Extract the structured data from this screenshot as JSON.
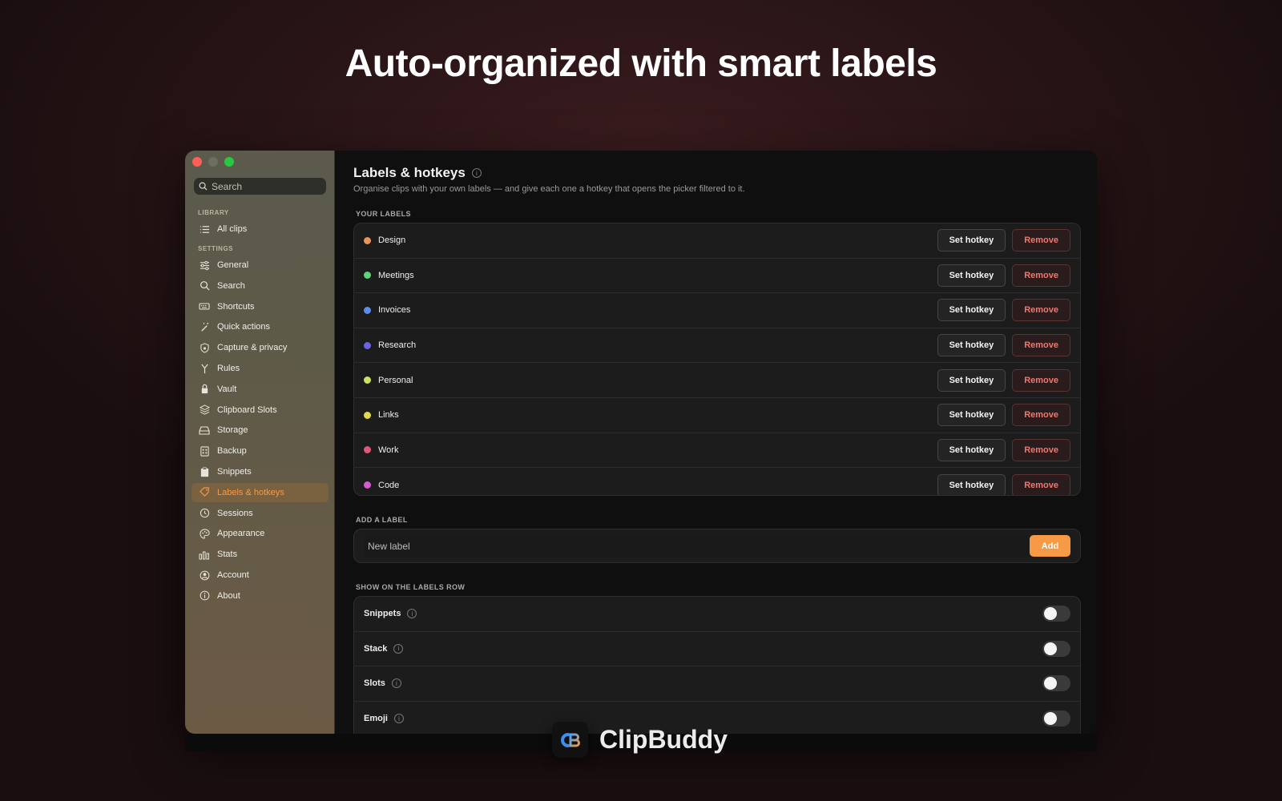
{
  "headline": "Auto-organized with smart labels",
  "sidebar": {
    "search_placeholder": "Search",
    "library_label": "LIBRARY",
    "settings_label": "SETTINGS",
    "library_items": [
      {
        "label": "All clips",
        "icon": "list-icon"
      }
    ],
    "settings_items": [
      {
        "label": "General",
        "icon": "sliders-icon"
      },
      {
        "label": "Search",
        "icon": "search-icon"
      },
      {
        "label": "Shortcuts",
        "icon": "keyboard-icon"
      },
      {
        "label": "Quick actions",
        "icon": "wand-icon"
      },
      {
        "label": "Capture & privacy",
        "icon": "shield-icon"
      },
      {
        "label": "Rules",
        "icon": "branch-icon"
      },
      {
        "label": "Vault",
        "icon": "lock-icon"
      },
      {
        "label": "Clipboard Slots",
        "icon": "layers-icon"
      },
      {
        "label": "Storage",
        "icon": "drive-icon"
      },
      {
        "label": "Backup",
        "icon": "backup-icon"
      },
      {
        "label": "Snippets",
        "icon": "clipboard-icon"
      },
      {
        "label": "Labels & hotkeys",
        "icon": "tag-icon",
        "active": true
      },
      {
        "label": "Sessions",
        "icon": "history-icon"
      },
      {
        "label": "Appearance",
        "icon": "palette-icon"
      },
      {
        "label": "Stats",
        "icon": "chart-icon"
      },
      {
        "label": "Account",
        "icon": "account-icon"
      },
      {
        "label": "About",
        "icon": "info-icon"
      }
    ]
  },
  "main": {
    "title": "Labels & hotkeys",
    "subtitle": "Organise clips with your own labels — and give each one a hotkey that opens the picker filtered to it.",
    "your_labels_heading": "YOUR LABELS",
    "set_hotkey_label": "Set hotkey",
    "remove_label": "Remove",
    "labels": [
      {
        "name": "Design",
        "color": "#e8935a"
      },
      {
        "name": "Meetings",
        "color": "#5fd27a"
      },
      {
        "name": "Invoices",
        "color": "#5b8ee8"
      },
      {
        "name": "Research",
        "color": "#6b63e0"
      },
      {
        "name": "Personal",
        "color": "#cfe060"
      },
      {
        "name": "Links",
        "color": "#e0d850"
      },
      {
        "name": "Work",
        "color": "#e0567a"
      },
      {
        "name": "Code",
        "color": "#d65ad0"
      }
    ],
    "add_label_heading": "ADD A LABEL",
    "add_label_placeholder": "New label",
    "add_button": "Add",
    "labels_row_heading": "SHOW ON THE LABELS ROW",
    "toggles": [
      {
        "label": "Snippets",
        "on": false
      },
      {
        "label": "Stack",
        "on": false
      },
      {
        "label": "Slots",
        "on": false
      },
      {
        "label": "Emoji",
        "on": false
      }
    ]
  },
  "brand": {
    "name": "ClipBuddy",
    "logo_text": "CB"
  }
}
